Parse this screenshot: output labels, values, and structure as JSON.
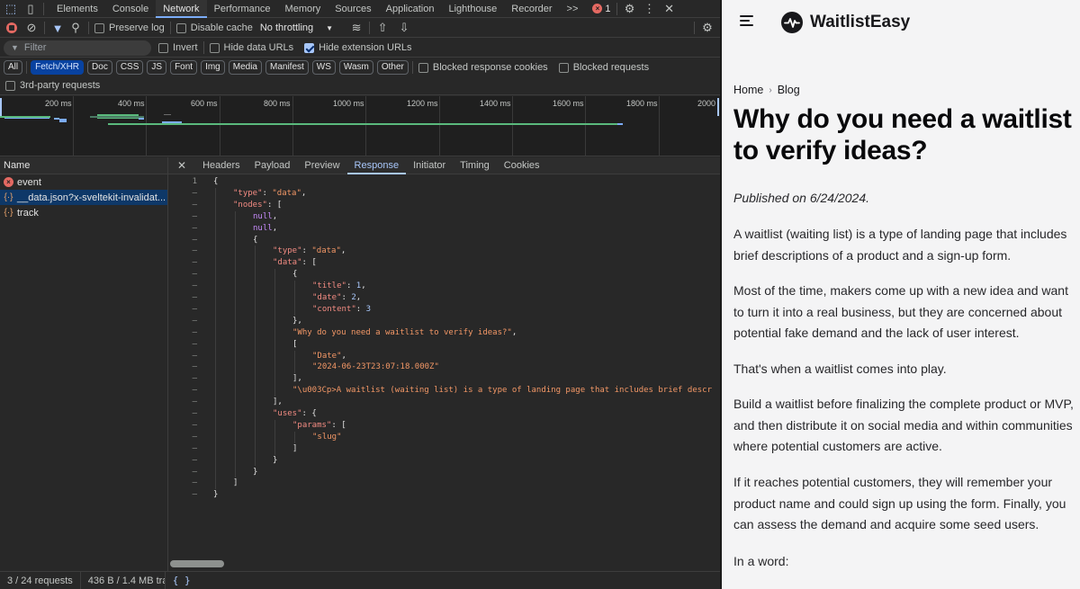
{
  "devtools": {
    "tabs": [
      "Elements",
      "Console",
      "Network",
      "Performance",
      "Memory",
      "Sources",
      "Application",
      "Lighthouse",
      "Recorder"
    ],
    "active_tab": "Network",
    "more_tabs": ">>",
    "error_count": "1",
    "toolbar": {
      "preserve_log": "Preserve log",
      "disable_cache": "Disable cache",
      "throttling": "No throttling"
    },
    "filter": {
      "placeholder": "Filter",
      "invert": "Invert",
      "hide_data_urls": "Hide data URLs",
      "hide_extension_urls": "Hide extension URLs"
    },
    "type_filters": [
      "All",
      "Fetch/XHR",
      "Doc",
      "CSS",
      "JS",
      "Font",
      "Img",
      "Media",
      "Manifest",
      "WS",
      "Wasm",
      "Other"
    ],
    "active_type": "Fetch/XHR",
    "blocked_response_cookies": "Blocked response cookies",
    "blocked_requests": "Blocked requests",
    "third_party": "3rd-party requests",
    "timeline_ticks": [
      "200 ms",
      "400 ms",
      "600 ms",
      "800 ms",
      "1000 ms",
      "1200 ms",
      "1400 ms",
      "1600 ms",
      "1800 ms",
      "2000"
    ],
    "name_header": "Name",
    "requests": [
      {
        "name": "event",
        "icon": "error-icon"
      },
      {
        "name": "__data.json?x-sveltekit-invalidat...",
        "icon": "braces-icon"
      },
      {
        "name": "track",
        "icon": "braces-icon"
      }
    ],
    "detail_tabs": [
      "Headers",
      "Payload",
      "Preview",
      "Response",
      "Initiator",
      "Timing",
      "Cookies"
    ],
    "active_detail_tab": "Response",
    "status": {
      "requests": "3 / 24 requests",
      "transferred": "436 B / 1.4 MB tran",
      "format": "{ }"
    }
  },
  "response_lines": [
    {
      "g": "1",
      "d": 0,
      "t": [
        [
          "p",
          "{"
        ]
      ]
    },
    {
      "g": "–",
      "d": 1,
      "t": [
        [
          "k",
          "\"type\""
        ],
        [
          "p",
          ": "
        ],
        [
          "s",
          "\"data\""
        ],
        [
          "p",
          ","
        ]
      ]
    },
    {
      "g": "–",
      "d": 1,
      "t": [
        [
          "k",
          "\"nodes\""
        ],
        [
          "p",
          ": ["
        ]
      ]
    },
    {
      "g": "–",
      "d": 2,
      "t": [
        [
          "nl",
          "null"
        ],
        [
          "p",
          ","
        ]
      ]
    },
    {
      "g": "–",
      "d": 2,
      "t": [
        [
          "nl",
          "null"
        ],
        [
          "p",
          ","
        ]
      ]
    },
    {
      "g": "–",
      "d": 2,
      "t": [
        [
          "p",
          "{"
        ]
      ]
    },
    {
      "g": "–",
      "d": 3,
      "t": [
        [
          "k",
          "\"type\""
        ],
        [
          "p",
          ": "
        ],
        [
          "s",
          "\"data\""
        ],
        [
          "p",
          ","
        ]
      ]
    },
    {
      "g": "–",
      "d": 3,
      "t": [
        [
          "k",
          "\"data\""
        ],
        [
          "p",
          ": ["
        ]
      ]
    },
    {
      "g": "–",
      "d": 4,
      "t": [
        [
          "p",
          "{"
        ]
      ]
    },
    {
      "g": "–",
      "d": 5,
      "t": [
        [
          "k",
          "\"title\""
        ],
        [
          "p",
          ": "
        ],
        [
          "n",
          "1"
        ],
        [
          "p",
          ","
        ]
      ]
    },
    {
      "g": "–",
      "d": 5,
      "t": [
        [
          "k",
          "\"date\""
        ],
        [
          "p",
          ": "
        ],
        [
          "n",
          "2"
        ],
        [
          "p",
          ","
        ]
      ]
    },
    {
      "g": "–",
      "d": 5,
      "t": [
        [
          "k",
          "\"content\""
        ],
        [
          "p",
          ": "
        ],
        [
          "n",
          "3"
        ]
      ]
    },
    {
      "g": "–",
      "d": 4,
      "t": [
        [
          "p",
          "},"
        ]
      ]
    },
    {
      "g": "–",
      "d": 4,
      "t": [
        [
          "s",
          "\"Why do you need a waitlist to verify ideas?\""
        ],
        [
          "p",
          ","
        ]
      ]
    },
    {
      "g": "–",
      "d": 4,
      "t": [
        [
          "p",
          "["
        ]
      ]
    },
    {
      "g": "–",
      "d": 5,
      "t": [
        [
          "s",
          "\"Date\""
        ],
        [
          "p",
          ","
        ]
      ]
    },
    {
      "g": "–",
      "d": 5,
      "t": [
        [
          "s",
          "\"2024-06-23T23:07:18.000Z\""
        ]
      ]
    },
    {
      "g": "–",
      "d": 4,
      "t": [
        [
          "p",
          "],"
        ]
      ]
    },
    {
      "g": "–",
      "d": 4,
      "t": [
        [
          "s",
          "\"\\u003Cp>A waitlist (waiting list) is a type of landing page that includes brief descr"
        ]
      ]
    },
    {
      "g": "–",
      "d": 3,
      "t": [
        [
          "p",
          "],"
        ]
      ]
    },
    {
      "g": "–",
      "d": 3,
      "t": [
        [
          "k",
          "\"uses\""
        ],
        [
          "p",
          ": {"
        ]
      ]
    },
    {
      "g": "–",
      "d": 4,
      "t": [
        [
          "k",
          "\"params\""
        ],
        [
          "p",
          ": ["
        ]
      ]
    },
    {
      "g": "–",
      "d": 5,
      "t": [
        [
          "s",
          "\"slug\""
        ]
      ]
    },
    {
      "g": "–",
      "d": 4,
      "t": [
        [
          "p",
          "]"
        ]
      ]
    },
    {
      "g": "–",
      "d": 3,
      "t": [
        [
          "p",
          "}"
        ]
      ]
    },
    {
      "g": "–",
      "d": 2,
      "t": [
        [
          "p",
          "}"
        ]
      ]
    },
    {
      "g": "–",
      "d": 1,
      "t": [
        [
          "p",
          "]"
        ]
      ]
    },
    {
      "g": "–",
      "d": 0,
      "t": [
        [
          "p",
          "}"
        ]
      ]
    }
  ],
  "page": {
    "brand": "WaitlistEasy",
    "breadcrumb": {
      "home": "Home",
      "current": "Blog"
    },
    "title": "Why do you need a waitlist to verify ideas?",
    "published": "Published on 6/24/2024.",
    "paragraphs": [
      "A waitlist (waiting list) is a type of landing page that includes brief descriptions of a product and a sign-up form.",
      "Most of the time, makers come up with a new idea and want to turn it into a real business, but they are concerned about potential fake demand and the lack of user interest.",
      "That's when a waitlist comes into play.",
      "Build a waitlist before finalizing the complete product or MVP, and then distribute it on social media and within communities where potential customers are active.",
      "If it reaches potential customers, they will remember your product name and could sign up using the form. Finally, you can assess the demand and acquire some seed users.",
      "In a word:"
    ]
  }
}
